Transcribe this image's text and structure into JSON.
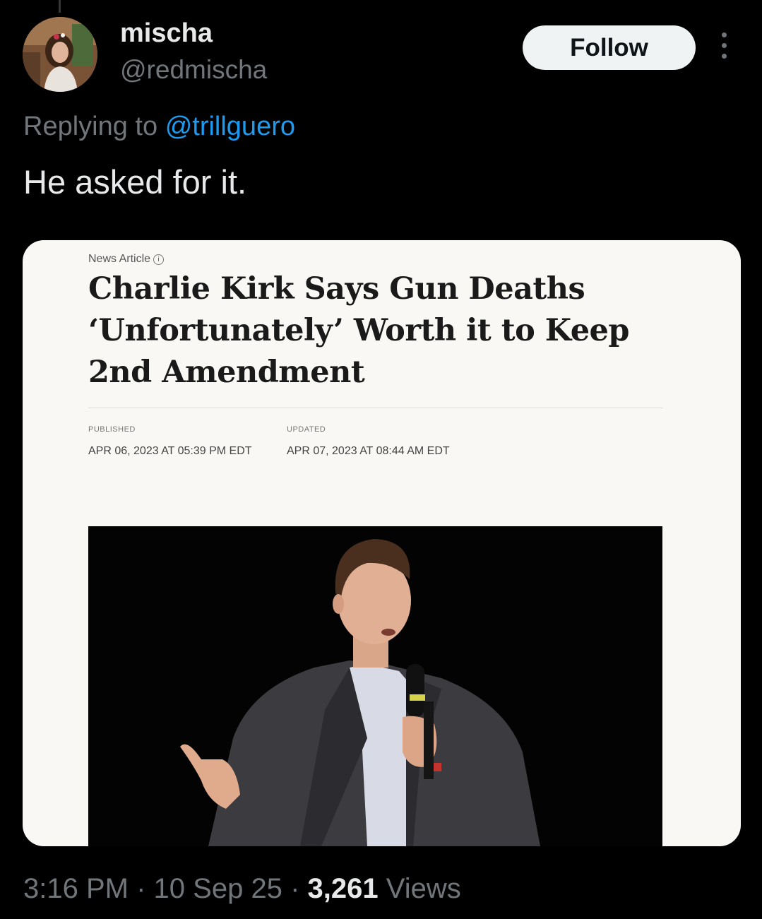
{
  "user": {
    "name": "mischa",
    "handle": "@redmischa"
  },
  "follow_label": "Follow",
  "reply": {
    "prefix": "Replying to",
    "target": "@trillguero"
  },
  "tweet_text": "He asked for it.",
  "article": {
    "kicker": "News Article",
    "info_glyph": "i",
    "headline": "Charlie Kirk Says Gun Deaths ‘Unfortunately’ Worth it to Keep 2nd Amendment",
    "published_label": "PUBLISHED",
    "published_value": "APR 06, 2023 AT 05:39 PM EDT",
    "updated_label": "UPDATED",
    "updated_value": "APR 07, 2023 AT 08:44 AM EDT"
  },
  "meta": {
    "time": "3:16 PM",
    "sep": "·",
    "date": "10 Sep 25",
    "views_count": "3,261",
    "views_label": "Views"
  },
  "colors": {
    "background": "#000000",
    "link": "#1d9bf0",
    "secondary_text": "#71767b",
    "card_bg": "#faf8f4"
  },
  "icons": [
    "more-options-icon",
    "info-icon"
  ]
}
